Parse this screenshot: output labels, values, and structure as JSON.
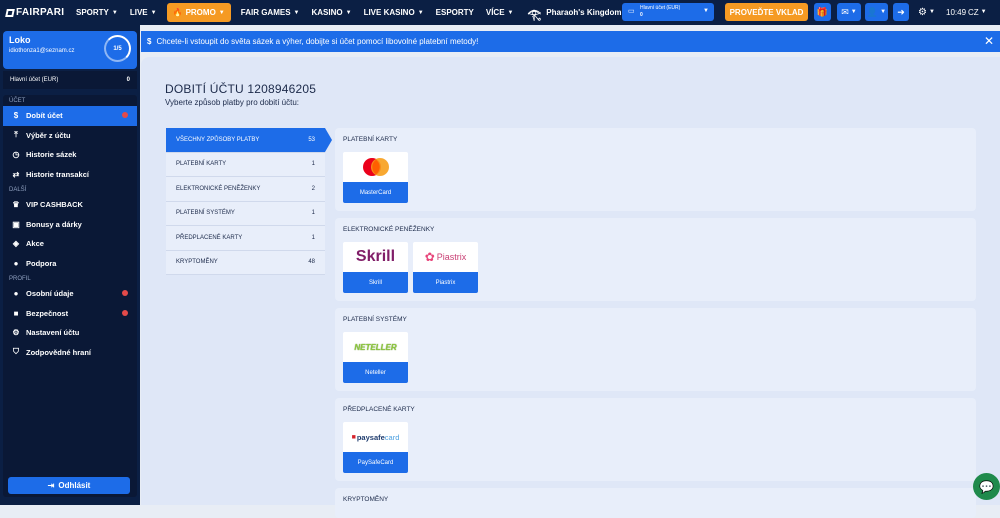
{
  "topbar": {
    "logo": "FAIRPARI",
    "nav": [
      {
        "label": "SPORTY",
        "chevron": true
      },
      {
        "label": "LIVE",
        "chevron": true
      },
      {
        "label": "PROMO",
        "chevron": true,
        "highlight": true,
        "icon": "fire-icon"
      },
      {
        "label": "FAIR GAMES",
        "chevron": true
      },
      {
        "label": "KASINO",
        "chevron": true
      },
      {
        "label": "LIVE KASINO",
        "chevron": true
      },
      {
        "label": "ESPORTY",
        "chevron": false
      },
      {
        "label": "VÍCE",
        "chevron": true
      }
    ],
    "featured": "Pharaoh's Kingdom",
    "account_label": "Hlavní účet (EUR)",
    "account_value": "0",
    "deposit_label": "PROVEĎTE VKLAD",
    "time": "10:49",
    "language": "CZ"
  },
  "sidebar": {
    "user_name": "Loko",
    "user_email": "idiothonza1@seznam.cz",
    "level": "1/5",
    "main_account_label": "Hlavní účet (EUR)",
    "main_account_value": "0",
    "sections": [
      {
        "title": "ÚČET",
        "items": [
          {
            "label": "Dobít účet",
            "icon": "dollar-icon",
            "active": true,
            "alert": true
          },
          {
            "label": "Výběr z účtu",
            "icon": "withdraw-icon",
            "active": false,
            "alert": false
          },
          {
            "label": "Historie sázek",
            "icon": "clock-icon",
            "active": false,
            "alert": false
          },
          {
            "label": "Historie transakcí",
            "icon": "transfer-icon",
            "active": false,
            "alert": false
          }
        ]
      },
      {
        "title": "DALŠÍ",
        "items": [
          {
            "label": "VIP CASHBACK",
            "icon": "crown-icon",
            "active": false,
            "alert": false
          },
          {
            "label": "Bonusy a dárky",
            "icon": "gift-icon",
            "active": false,
            "alert": false
          },
          {
            "label": "Akce",
            "icon": "tag-icon",
            "active": false,
            "alert": false
          },
          {
            "label": "Podpora",
            "icon": "support-icon",
            "active": false,
            "alert": false
          }
        ]
      },
      {
        "title": "PROFIL",
        "items": [
          {
            "label": "Osobní údaje",
            "icon": "user-icon",
            "active": false,
            "alert": true
          },
          {
            "label": "Bezpečnost",
            "icon": "lock-icon",
            "active": false,
            "alert": true
          },
          {
            "label": "Nastavení účtu",
            "icon": "gear-icon",
            "active": false,
            "alert": false
          },
          {
            "label": "Zodpovědné hraní",
            "icon": "shield-icon",
            "active": false,
            "alert": false
          }
        ]
      }
    ],
    "logout_label": "Odhlásit"
  },
  "banner": {
    "text": "Chcete-li vstoupit do světa sázek a výher, dobijte si účet pomocí libovolné platební metody!"
  },
  "main": {
    "title": "DOBITÍ ÚČTU 1208946205",
    "subtitle": "Vyberte způsob platby pro dobití účtu:",
    "filters": [
      {
        "label": "VŠECHNY ZPŮSOBY PLATBY",
        "count": "53",
        "active": true
      },
      {
        "label": "PLATEBNÍ KARTY",
        "count": "1",
        "active": false
      },
      {
        "label": "ELEKTRONICKÉ PENĚŽENKY",
        "count": "2",
        "active": false
      },
      {
        "label": "PLATEBNÍ SYSTÉMY",
        "count": "1",
        "active": false
      },
      {
        "label": "PŘEDPLACENÉ KARTY",
        "count": "1",
        "active": false
      },
      {
        "label": "KRYPTOMĚNY",
        "count": "48",
        "active": false
      }
    ],
    "categories": [
      {
        "title": "PLATEBNÍ KARTY",
        "methods": [
          {
            "label": "MasterCard",
            "logo": "mastercard"
          }
        ]
      },
      {
        "title": "ELEKTRONICKÉ PENĚŽENKY",
        "methods": [
          {
            "label": "Skrill",
            "logo": "skrill",
            "logo_text": "Skrill"
          },
          {
            "label": "Piastrix",
            "logo": "piastrix",
            "logo_text": "Piastrix"
          }
        ]
      },
      {
        "title": "PLATEBNÍ SYSTÉMY",
        "methods": [
          {
            "label": "Neteller",
            "logo": "neteller",
            "logo_text": "NETELLER"
          }
        ]
      },
      {
        "title": "PŘEDPLACENÉ KARTY",
        "methods": [
          {
            "label": "PaySafeCard",
            "logo": "paysafecard",
            "logo_text_a": "paysafe",
            "logo_text_b": "card"
          }
        ]
      },
      {
        "title": "KRYPTOMĚNY",
        "methods": []
      }
    ]
  },
  "colors": {
    "brand_blue": "#1d6ce8",
    "navy": "#0b1f44",
    "orange": "#f59a23",
    "alert_red": "#e34a4a",
    "chat_green": "#1f8a4c"
  }
}
